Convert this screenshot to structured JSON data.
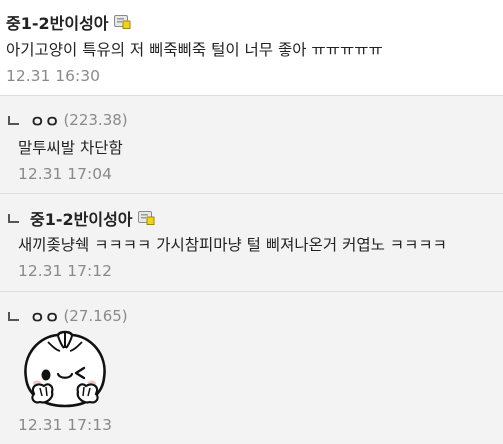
{
  "comments": [
    {
      "nickname": "중1-2반이성아",
      "text": "아기고양이 특유의 저 삐죽삐죽 털이 너무 좋아 ㅠㅠㅠㅠㅠ",
      "date": "12.31 16:30"
    },
    {
      "nickname": "ㅇㅇ",
      "ip": "(223.38)",
      "text": "말투씨발 차단함",
      "date": "12.31 17:04"
    },
    {
      "nickname": "중1-2반이성아",
      "text": "새끼좆냥쉑 ㅋㅋㅋㅋ 가시참피마냥 털 삐져나온거 커엽노 ㅋㅋㅋㅋ",
      "date": "12.31 17:12"
    },
    {
      "nickname": "ㅇㅇ",
      "ip": "(27.165)",
      "date": "12.31 17:13"
    }
  ],
  "icons": {
    "member_badge": "fixed-nick-badge-icon",
    "dccon": "dumpling-emoticon"
  }
}
